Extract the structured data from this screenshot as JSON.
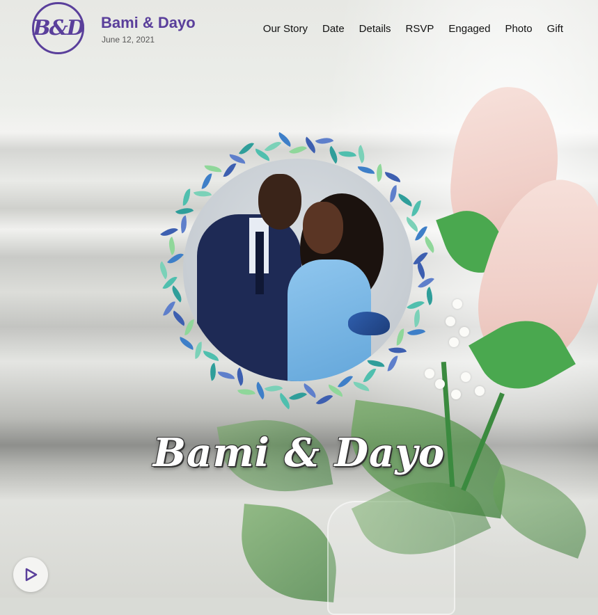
{
  "header": {
    "logo_text": "B&D",
    "title": "Bami & Dayo",
    "date": "June 12, 2021"
  },
  "nav": {
    "items": [
      {
        "label": "Our Story"
      },
      {
        "label": "Date"
      },
      {
        "label": "Details"
      },
      {
        "label": "RSVP"
      },
      {
        "label": "Engaged"
      },
      {
        "label": "Photo"
      },
      {
        "label": "Gift"
      }
    ]
  },
  "hero": {
    "script_title": "Bami & Dayo",
    "photo_caption_icon": "couple-photo",
    "play_icon": "play-icon"
  },
  "colors": {
    "brand": "#5a3f9b",
    "nav_text": "#111111",
    "script_text": "#ffffff"
  }
}
